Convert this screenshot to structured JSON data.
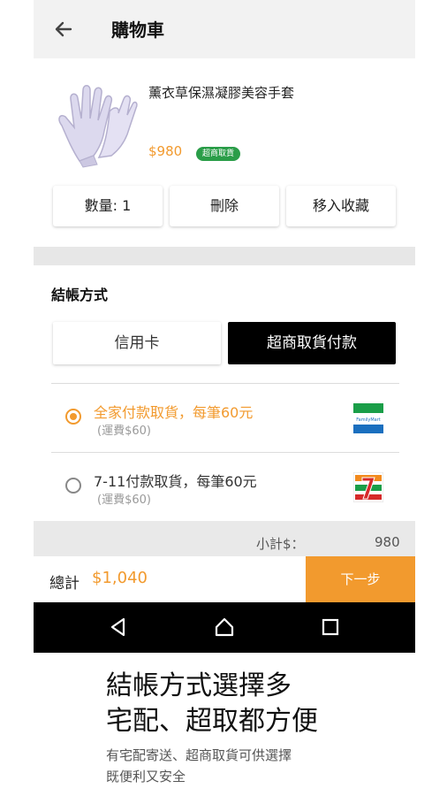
{
  "header": {
    "title": "購物車"
  },
  "product": {
    "name": "薰衣草保濕凝膠美容手套",
    "price": "$980",
    "badge": "超商取貨"
  },
  "actions": {
    "quantity": "數量: 1",
    "delete": "刪除",
    "favorite": "移入收藏"
  },
  "checkout": {
    "title": "結帳方式",
    "tabs": [
      {
        "label": "信用卡",
        "selected": false
      },
      {
        "label": "超商取貨付款",
        "selected": true
      }
    ],
    "options": [
      {
        "label": "全家付款取貨，每筆60元",
        "sub": "(運費$60)",
        "selected": true,
        "store": "FamilyMart",
        "store_icon": "familymart-logo-icon"
      },
      {
        "label": "7-11付款取貨，每筆60元",
        "sub": "(運費$60)",
        "selected": false,
        "store_icon": "seven-eleven-logo-icon"
      }
    ]
  },
  "summary": {
    "subtotal_label": "小計$：",
    "subtotal_value": "980",
    "total_label": "總計",
    "total_value": "$1,040",
    "next_label": "下一步"
  },
  "caption": {
    "line1": "結帳方式選擇多",
    "line2": "宅配、超取都方便",
    "sub1": "有宅配寄送、超商取貨可供選擇",
    "sub2": "既便利又安全"
  },
  "colors": {
    "accent": "#f29a2e",
    "badge_green": "#2a9d48",
    "active_tab": "#000000"
  }
}
